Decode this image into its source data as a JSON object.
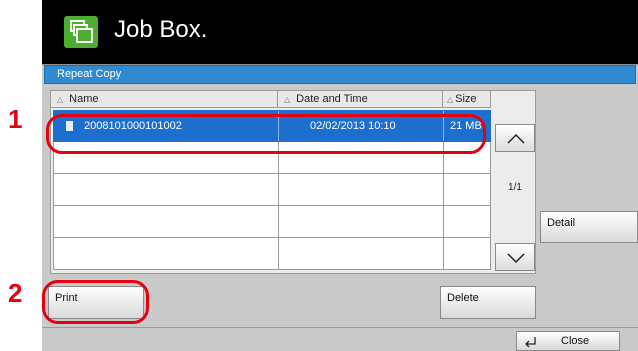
{
  "callouts": {
    "one": "1",
    "two": "2"
  },
  "header": {
    "title": "Job Box."
  },
  "subtitle": "Repeat Copy",
  "columns": {
    "name": "Name",
    "date": "Date and Time",
    "size": "Size"
  },
  "rows": [
    {
      "name": "2008101000101002",
      "date": "02/02/2013  10:10",
      "size": "21 MB",
      "selected": true
    },
    {
      "name": "",
      "date": "",
      "size": ""
    },
    {
      "name": "",
      "date": "",
      "size": ""
    },
    {
      "name": "",
      "date": "",
      "size": ""
    },
    {
      "name": "",
      "date": "",
      "size": ""
    }
  ],
  "pager": "1/1",
  "buttons": {
    "detail": "Detail",
    "print": "Print",
    "delete": "Delete",
    "close": "Close"
  },
  "colors": {
    "accent": "#1d6fcf",
    "callout": "#e3000f",
    "title_bar": "#2f8ad1"
  },
  "icons": [
    "job-box-icon",
    "file-icon",
    "sort-triangle-icon",
    "scroll-up-icon",
    "scroll-down-icon",
    "return-icon"
  ]
}
